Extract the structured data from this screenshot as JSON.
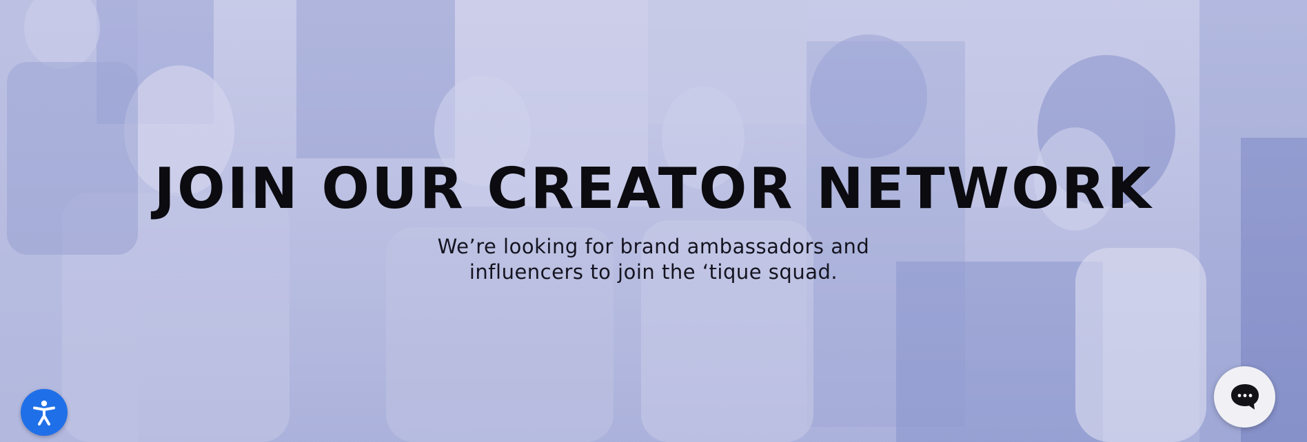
{
  "hero": {
    "headline": "JOIN OUR CREATOR NETWORK",
    "subtitle_line1": "We’re looking for brand ambassadors and",
    "subtitle_line2": "influencers to join the ‘tique squad.",
    "background_tint": "#aeb4dc"
  },
  "widgets": {
    "accessibility_icon": "accessibility-person-icon",
    "accessibility_color": "#1f6fe8",
    "chat_icon": "chat-bubble-icon",
    "chat_color": "#f1f1f5"
  }
}
